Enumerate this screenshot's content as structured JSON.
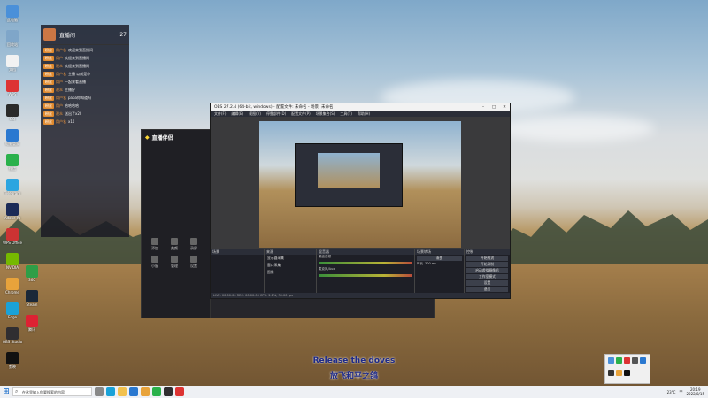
{
  "desktop": {
    "icons": [
      {
        "label": "此电脑",
        "color": "#4a90d9"
      },
      {
        "label": "回收站",
        "color": "#7fa6c9"
      },
      {
        "label": "文档",
        "color": "#f2f2f2"
      },
      {
        "label": "WPS",
        "color": "#d33"
      },
      {
        "label": "QQ",
        "color": "#2a2a2a"
      },
      {
        "label": "电脑管家",
        "color": "#2a78d0"
      },
      {
        "label": "微信",
        "color": "#2ab14b"
      },
      {
        "label": "Telegram",
        "color": "#2ca5e0"
      },
      {
        "label": "Adobe Ps",
        "color": "#1c2b57"
      },
      {
        "label": "WPS Office",
        "color": "#cc3333"
      },
      {
        "label": "NVIDIA",
        "color": "#76b900"
      },
      {
        "label": "Chrome",
        "color": "#e8a33b"
      },
      {
        "label": "Edge",
        "color": "#1aa2d8"
      },
      {
        "label": "OBS Studio",
        "color": "#302e31"
      },
      {
        "label": "剪映",
        "color": "#111"
      },
      {
        "label": "360",
        "color": "#2e9e47"
      },
      {
        "label": "Steam",
        "color": "#1b2838"
      },
      {
        "label": "腾讯",
        "color": "#d23"
      }
    ],
    "subtitle_en": "Release the doves",
    "subtitle_zh": "放飞和平之鸽"
  },
  "chat": {
    "title": "直播间",
    "count": "27",
    "messages": [
      {
        "badge": "粉丝",
        "name": "用户名",
        "text": "欢迎来到直播间"
      },
      {
        "badge": "粉丝",
        "name": "用户",
        "text": "欢迎来到直播间"
      },
      {
        "badge": "粉丝",
        "name": "观众",
        "text": "欢迎来到直播间"
      },
      {
        "badge": "粉丝",
        "name": "用户名",
        "text": "主播 以前是小"
      },
      {
        "badge": "粉丝",
        "name": "用户",
        "text": "一起来看直播"
      },
      {
        "badge": "粉丝",
        "name": "观众",
        "text": "主播好"
      },
      {
        "badge": "粉丝",
        "name": "用户名",
        "text": "papa你知道吗"
      },
      {
        "badge": "粉丝",
        "name": "用户",
        "text": "哈哈哈哈"
      },
      {
        "badge": "粉丝",
        "name": "观众",
        "text": "送出了x20"
      },
      {
        "badge": "粉丝",
        "name": "用户名",
        "text": "x10"
      }
    ]
  },
  "zhibo": {
    "logo": "直播伴侣",
    "tools": [
      "添加",
      "美颜",
      "录屏",
      "小窗",
      "管理",
      "设置"
    ]
  },
  "obs": {
    "title": "OBS 27.2.4 (64-bit, windows) - 配置文件: 未命名 - 场景: 未命名",
    "menu": [
      "文件(F)",
      "编辑(E)",
      "视图(V)",
      "停靠部件(D)",
      "配置文件(P)",
      "场景集合(S)",
      "工具(T)",
      "帮助(H)"
    ],
    "docks": {
      "scenes": "场景",
      "sources": "来源",
      "mixer": "混音器",
      "transitions": "场景转场",
      "controls": "控制"
    },
    "sources": [
      "显示器采集",
      "窗口采集",
      "图像"
    ],
    "mixer_labels": [
      "桌面音频",
      "麦克风/Aux"
    ],
    "transition": "渐变",
    "duration_label": "时长",
    "duration": "300 ms",
    "controls": [
      "开始推流",
      "开始录制",
      "启动虚拟摄像机",
      "工作室模式",
      "设置",
      "退出"
    ],
    "status": "LIVE: 00:00:00   REC: 00:00:00   CPU: 2.1%, 30.00 fps"
  },
  "taskbar": {
    "search_placeholder": "在这里输入你要搜索的内容",
    "time": "20:19",
    "date": "2022/8/15",
    "weather": "23°C",
    "lang": "中"
  },
  "colors": {
    "accent": "#e08a2e",
    "obs_bg": "#2b2e38"
  }
}
